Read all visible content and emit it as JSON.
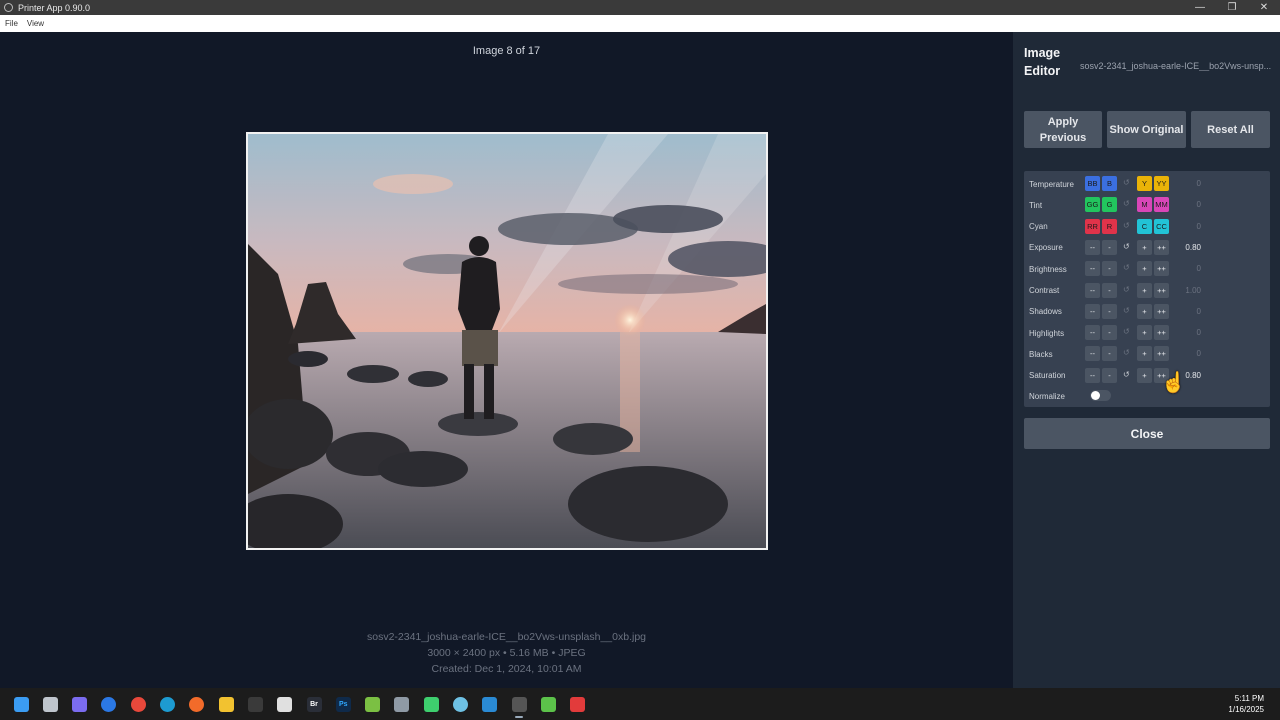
{
  "window": {
    "title": "Printer App 0.90.0",
    "minimize": "—",
    "maximize": "❐",
    "close": "✕"
  },
  "menu": [
    "File",
    "View"
  ],
  "viewer": {
    "counter": "Image 8 of 17",
    "filename": "sosv2-2341_joshua-earle-ICE__bo2Vws-unsplash__0xb.jpg",
    "details": "3000 × 2400 px • 5.16 MB • JPEG",
    "created": "Created: Dec 1, 2024, 10:01 AM"
  },
  "editor": {
    "title": "Image Editor",
    "filename": "sosv2-2341_joshua-earle-ICE__bo2Vws-unsp...",
    "buttons": {
      "apply_previous": "Apply Previous",
      "show_original": "Show Original",
      "reset_all": "Reset All"
    },
    "color_rows": [
      {
        "label": "Temperature",
        "b1": "BB",
        "b2": "B",
        "b3": "Y",
        "b4": "YY",
        "value": "0",
        "c1": "#3b6fe0",
        "c2": "#3b6fe0",
        "c3": "#eab308",
        "c4": "#eab308"
      },
      {
        "label": "Tint",
        "b1": "GG",
        "b2": "G",
        "b3": "M",
        "b4": "MM",
        "value": "0",
        "c1": "#22c55e",
        "c2": "#22c55e",
        "c3": "#d946b8",
        "c4": "#d946b8"
      },
      {
        "label": "Cyan",
        "b1": "RR",
        "b2": "R",
        "b3": "C",
        "b4": "CC",
        "value": "0",
        "c1": "#e0334a",
        "c2": "#e0334a",
        "c3": "#22c3d6",
        "c4": "#22c3d6"
      }
    ],
    "tone_rows": [
      {
        "label": "Exposure",
        "value": "0.80",
        "active": true
      },
      {
        "label": "Brightness",
        "value": "0",
        "active": false
      },
      {
        "label": "Contrast",
        "value": "1.00",
        "active": false
      },
      {
        "label": "Shadows",
        "value": "0",
        "active": false
      },
      {
        "label": "Highlights",
        "value": "0",
        "active": false
      },
      {
        "label": "Blacks",
        "value": "0",
        "active": false
      },
      {
        "label": "Saturation",
        "value": "0.80",
        "active": true
      }
    ],
    "step_labels": {
      "minus2": "--",
      "minus1": "-",
      "reset": "↺",
      "plus1": "+",
      "plus2": "++"
    },
    "normalize_label": "Normalize",
    "normalize_on": false,
    "close_label": "Close"
  },
  "taskbar": {
    "icons": [
      "windows-start",
      "task-view",
      "copilot",
      "app-blue",
      "chrome",
      "edge",
      "firefox",
      "file-explorer",
      "app-dark",
      "slack",
      "bridge",
      "photoshop",
      "notepad-plus",
      "calculator",
      "app-green",
      "app-circle",
      "vscode",
      "printer-app",
      "app-green-2",
      "app-red"
    ],
    "bridge_text": "Br",
    "photoshop_text": "Ps",
    "time": "5:11 PM",
    "date": "1/16/2025"
  }
}
